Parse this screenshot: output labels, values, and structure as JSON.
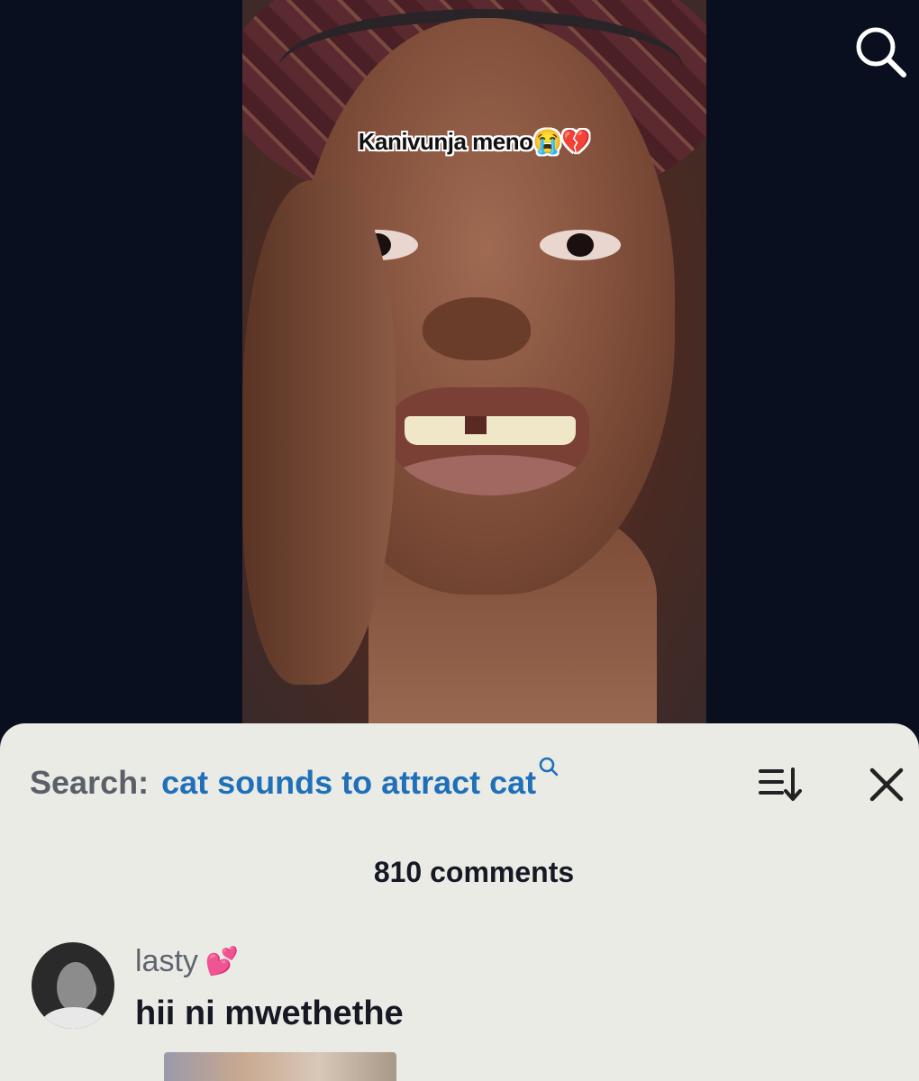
{
  "video": {
    "caption_text": "Kanivunja meno",
    "caption_emojis": "😭💔"
  },
  "top_bar": {
    "search_icon": "search-icon"
  },
  "comments_panel": {
    "search_label": "Search:",
    "search_query": "cat sounds to attract cat",
    "search_query_icon": "search-icon",
    "sort_icon": "sort-icon",
    "close_icon": "close-icon",
    "comment_count": "810 comments",
    "comments": [
      {
        "username": "lasty",
        "username_emoji": "💕",
        "text": "hii ni mwethethe"
      }
    ]
  },
  "colors": {
    "search_label": "#5a5f68",
    "search_query": "#1f70b8",
    "sheet_bg": "#ebebe6",
    "page_bg": "#0b1020"
  }
}
